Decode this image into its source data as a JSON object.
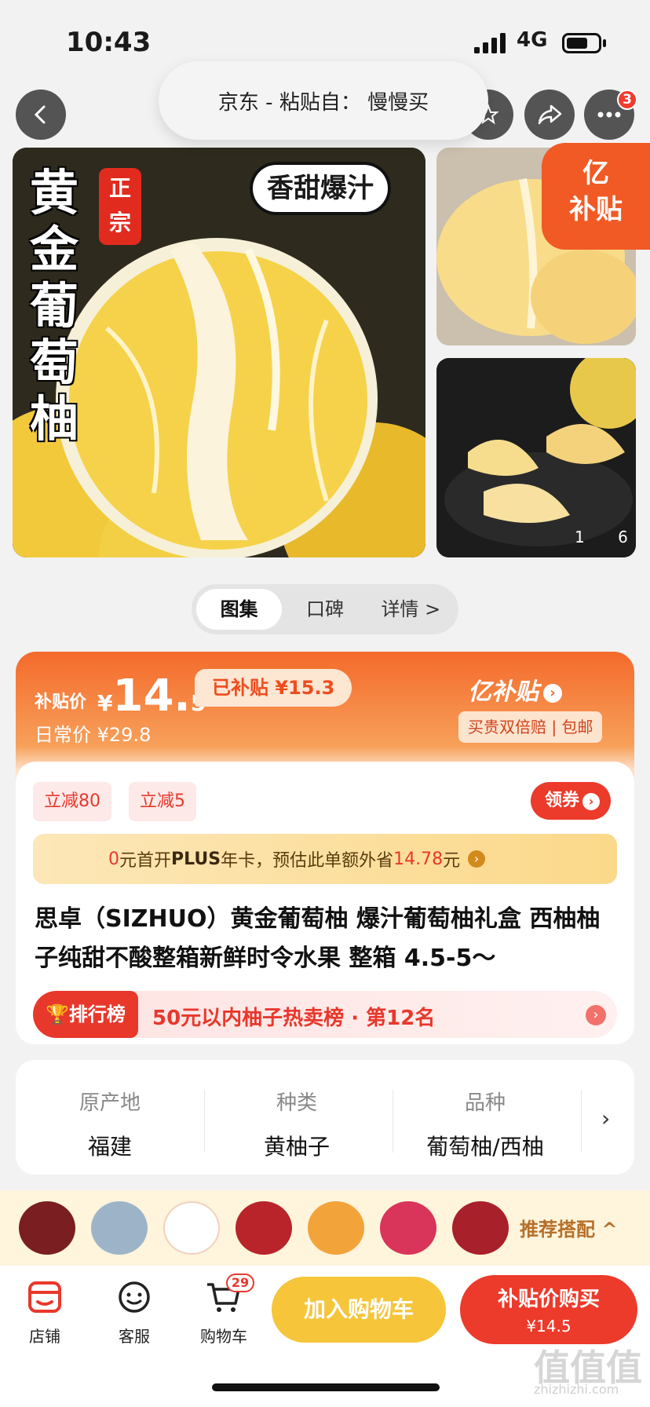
{
  "status_bar": {
    "time": "10:43",
    "network": "4G"
  },
  "nav": {
    "paste_notice": "京东 - 粘贴自： 慢慢买",
    "more_badge": "3"
  },
  "gallery": {
    "title_vertical": "黄金葡萄柚",
    "badge_zhengzong": "正宗",
    "tag_sweet": "香甜爆汁",
    "subsidy_badge_line1": "亿",
    "subsidy_badge_line2": "补贴",
    "counter": "1 6"
  },
  "tabs": [
    {
      "label": "图集"
    },
    {
      "label": "口碑"
    },
    {
      "label": "详情 >"
    }
  ],
  "price": {
    "label": "补贴价",
    "currency": "¥",
    "integer": "14.",
    "decimal": "5",
    "subsidized": "已补贴 ¥15.3",
    "normal": "日常价 ¥29.8",
    "brand": "亿补贴",
    "guarantee": "买贵双倍赔 | 包邮"
  },
  "coupons": {
    "items": [
      "立减80",
      "立减5"
    ],
    "claim_label": "领券"
  },
  "plus": {
    "prefix": "0",
    "middle1": "元首开",
    "plus_word": "PLUS",
    "middle2": "年卡，预估此单额外省",
    "amount": "14.78",
    "suffix": "元"
  },
  "product": {
    "title": "思卓（SIZHUO）黄金葡萄柚 爆汁葡萄柚礼盒 西柚柚子纯甜不酸整箱新鲜时令水果 整箱 4.5-5～"
  },
  "rank": {
    "tag": "排行榜",
    "text": "50元以内柚子热卖榜 · 第12名"
  },
  "attributes": [
    {
      "key": "原产地",
      "value": "福建"
    },
    {
      "key": "种类",
      "value": "黄柚子"
    },
    {
      "key": "品种",
      "value": "葡萄柚/西柚"
    }
  ],
  "recommend": {
    "label": "推荐搭配 ^"
  },
  "bottom": {
    "store": "店铺",
    "service": "客服",
    "cart": "购物车",
    "cart_count": "29",
    "add_to_cart": "加入购物车",
    "buy_label": "补贴价购买",
    "buy_price": "¥14.5"
  },
  "watermark": {
    "main": "值值值",
    "sub": "zhizhizhi.com"
  },
  "colors": {
    "accent": "#ec3a2b",
    "orange": "#f46a2b",
    "yellow": "#f6c53a"
  }
}
